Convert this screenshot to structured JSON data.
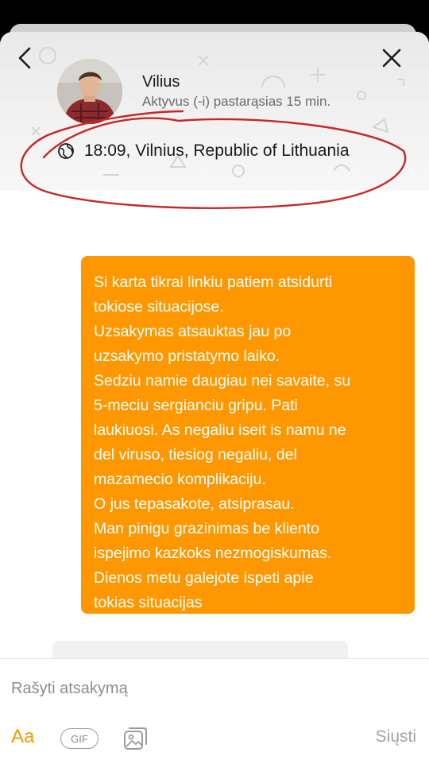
{
  "contact": {
    "name": "Vilius",
    "status": "Aktyvus (-i) pastarąsias 15 min.",
    "local_time": "18:09, Vilnius, Republic of Lithuania"
  },
  "message": {
    "lines": [
      "Si karta tikrai linkiu patiem atsidurti",
      "tokiose situacijose.",
      "Uzsakymas atsauktas jau po",
      "uzsakymo pristatymo laiko.",
      "Sedziu namie daugiau nei savaite, su",
      "5-meciu sergianciu gripu. Pati",
      "laukiuosi. As negaliu iseit is namu ne",
      "del viruso, tiesiog negaliu, del",
      "mazamecio komplikaciju.",
      "O jus tepasakote, atsiprasau.",
      "Man pinigu grazinimas be kliento",
      "ispejimo kazkoks nezmogiskumas.",
      "Dienos metu galejote ispeti apie",
      "tokias situacijas"
    ],
    "bubble_color": "#ff9800"
  },
  "composer": {
    "placeholder": "Rašyti atsakymą",
    "format_label": "Aa",
    "gif_label": "GIF",
    "send_label": "Siųsti"
  },
  "icons": {
    "back": "chevron-left-icon",
    "close": "close-icon",
    "time_zone": "globe-icon",
    "image": "image-gallery-icon"
  },
  "colors": {
    "accent": "#ff9800",
    "annotation": "#c62828"
  }
}
